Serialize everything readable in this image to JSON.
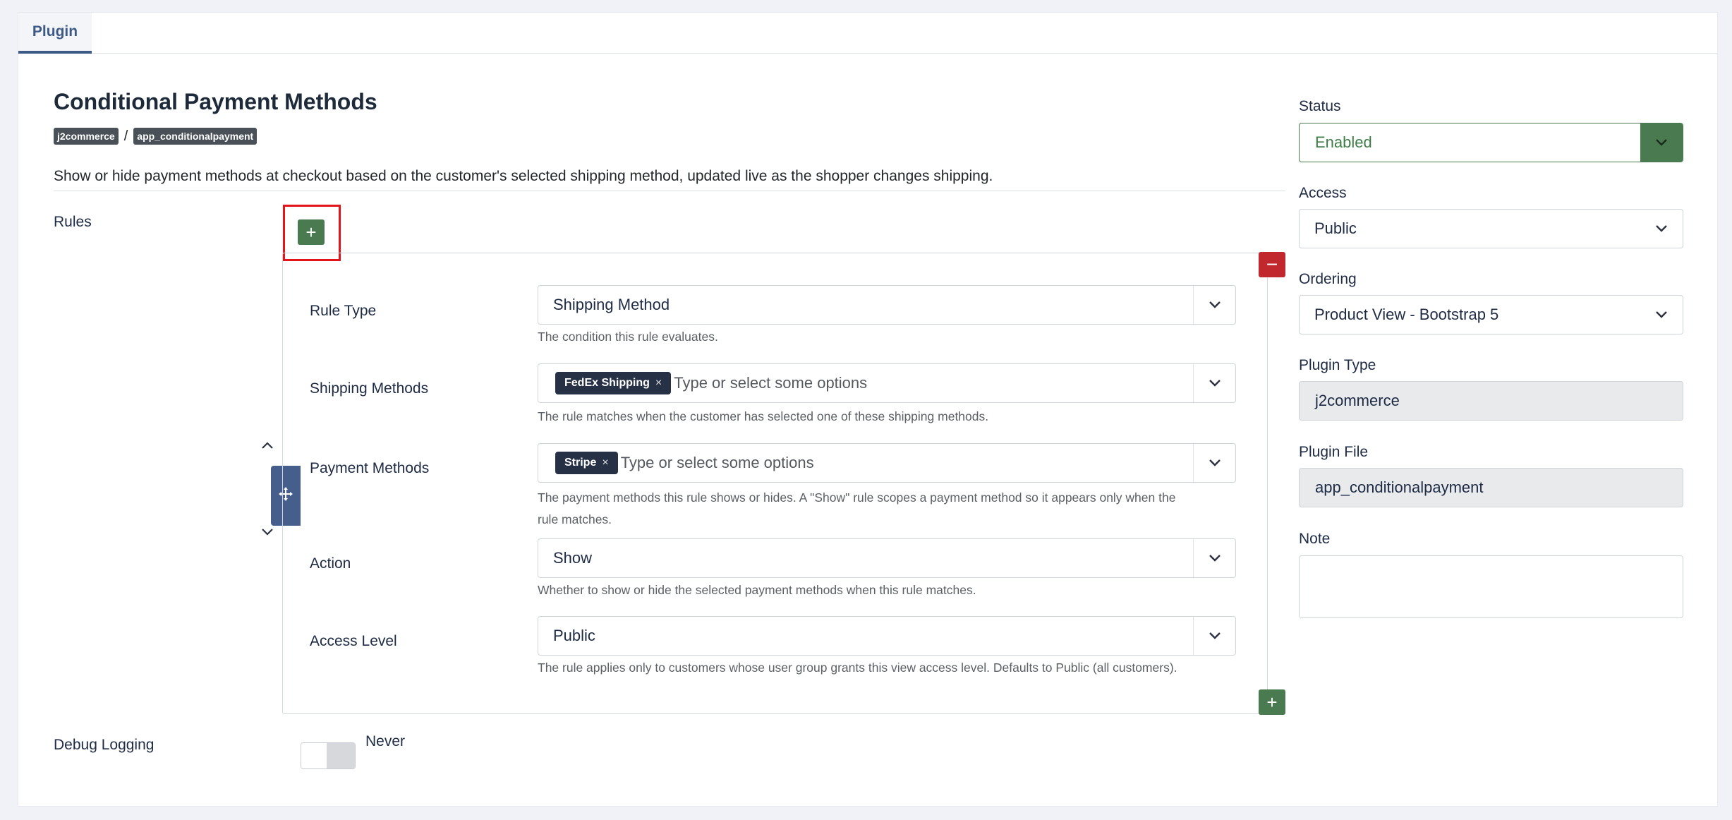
{
  "tabs": [
    {
      "label": "Plugin"
    }
  ],
  "page": {
    "title": "Conditional Payment Methods",
    "badges": [
      "j2commerce",
      "app_conditionalpayment"
    ],
    "badge_separator": "/",
    "description": "Show or hide payment methods at checkout based on the customer's selected shipping method, updated live as the shopper changes shipping."
  },
  "rules": {
    "label": "Rules",
    "add_icon": "plus-icon",
    "remove_icon": "minus-icon",
    "move_icon": "move-icon",
    "fields": {
      "rule_type": {
        "label": "Rule Type",
        "value": "Shipping Method",
        "help": "The condition this rule evaluates."
      },
      "shipping_methods": {
        "label": "Shipping Methods",
        "selected": [
          "FedEx Shipping"
        ],
        "placeholder": "Type or select some options",
        "help": "The rule matches when the customer has selected one of these shipping methods."
      },
      "payment_methods": {
        "label": "Payment Methods",
        "selected": [
          "Stripe"
        ],
        "placeholder": "Type or select some options",
        "help_line1": "The payment methods this rule shows or hides. A \"Show\" rule scopes a payment method so it appears only when the",
        "help_line2": "rule matches."
      },
      "action": {
        "label": "Action",
        "value": "Show",
        "help": "Whether to show or hide the selected payment methods when this rule matches."
      },
      "access_level": {
        "label": "Access Level",
        "value": "Public",
        "help": "The rule applies only to customers whose user group grants this view access level. Defaults to Public (all customers)."
      }
    }
  },
  "debug": {
    "label": "Debug Logging",
    "value": "Never"
  },
  "sidebar": {
    "status": {
      "label": "Status",
      "value": "Enabled"
    },
    "access": {
      "label": "Access",
      "value": "Public"
    },
    "ordering": {
      "label": "Ordering",
      "value": "Product View - Bootstrap 5"
    },
    "plugin_type": {
      "label": "Plugin Type",
      "value": "j2commerce"
    },
    "plugin_file": {
      "label": "Plugin File",
      "value": "app_conditionalpayment"
    },
    "note": {
      "label": "Note",
      "value": ""
    }
  },
  "colors": {
    "primary": "#3c5a85",
    "success": "#4a7a4f",
    "danger": "#c0282d",
    "chip": "#273146",
    "highlight": "#e3141a"
  }
}
